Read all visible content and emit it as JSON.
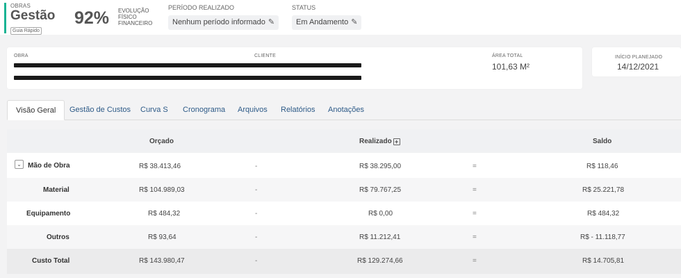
{
  "header": {
    "module_label": "OBRAS",
    "module_title": "Gestão",
    "guide_label": "Guia Rápido",
    "progress_value": "92%",
    "progress_label_1": "EVOLUÇÃO",
    "progress_label_2": "FÍSICO",
    "progress_label_3": "FINANCEIRO",
    "period_label": "PERÍODO REALIZADO",
    "period_value": "Nenhum período informado",
    "status_label": "STATUS",
    "status_value": "Em Andamento"
  },
  "info": {
    "obra_label": "OBRA",
    "cliente_label": "CLIENTE",
    "area_label": "ÁREA TOTAL",
    "area_value": "101,63 M²",
    "start_label": "INÍCIO PLANEJADO",
    "start_value": "14/12/2021"
  },
  "tabs": [
    {
      "label": "Visão Geral",
      "active": true
    },
    {
      "label": "Gestão de Custos"
    },
    {
      "label": "Curva S"
    },
    {
      "label": "Cronograma"
    },
    {
      "label": "Arquivos"
    },
    {
      "label": "Relatórios"
    },
    {
      "label": "Anotações"
    }
  ],
  "table": {
    "headers": {
      "orcado": "Orçado",
      "realizado": "Realizado",
      "saldo": "Saldo"
    },
    "minus": "-",
    "equals": "=",
    "rows": [
      {
        "label": "Mão de Obra",
        "orcado": "R$ 38.413,46",
        "realizado": "R$ 38.295,00",
        "saldo": "R$ 118,46"
      },
      {
        "label": "Material",
        "orcado": "R$ 104.989,03",
        "realizado": "R$ 79.767,25",
        "saldo": "R$ 25.221,78"
      },
      {
        "label": "Equipamento",
        "orcado": "R$ 484,32",
        "realizado": "R$ 0,00",
        "saldo": "R$ 484,32"
      },
      {
        "label": "Outros",
        "orcado": "R$ 93,64",
        "realizado": "R$ 11.212,41",
        "saldo": "R$ - 11.118,77"
      },
      {
        "label": "Custo Total",
        "orcado": "R$ 143.980,47",
        "realizado": "R$ 129.274,66",
        "saldo": "R$ 14.705,81"
      }
    ]
  },
  "icons": {
    "edit": "edit-icon",
    "expand": "chevron-down-icon",
    "add": "plus-box-icon"
  },
  "colors": {
    "accent": "#1ab394",
    "link": "#2d5a87"
  }
}
